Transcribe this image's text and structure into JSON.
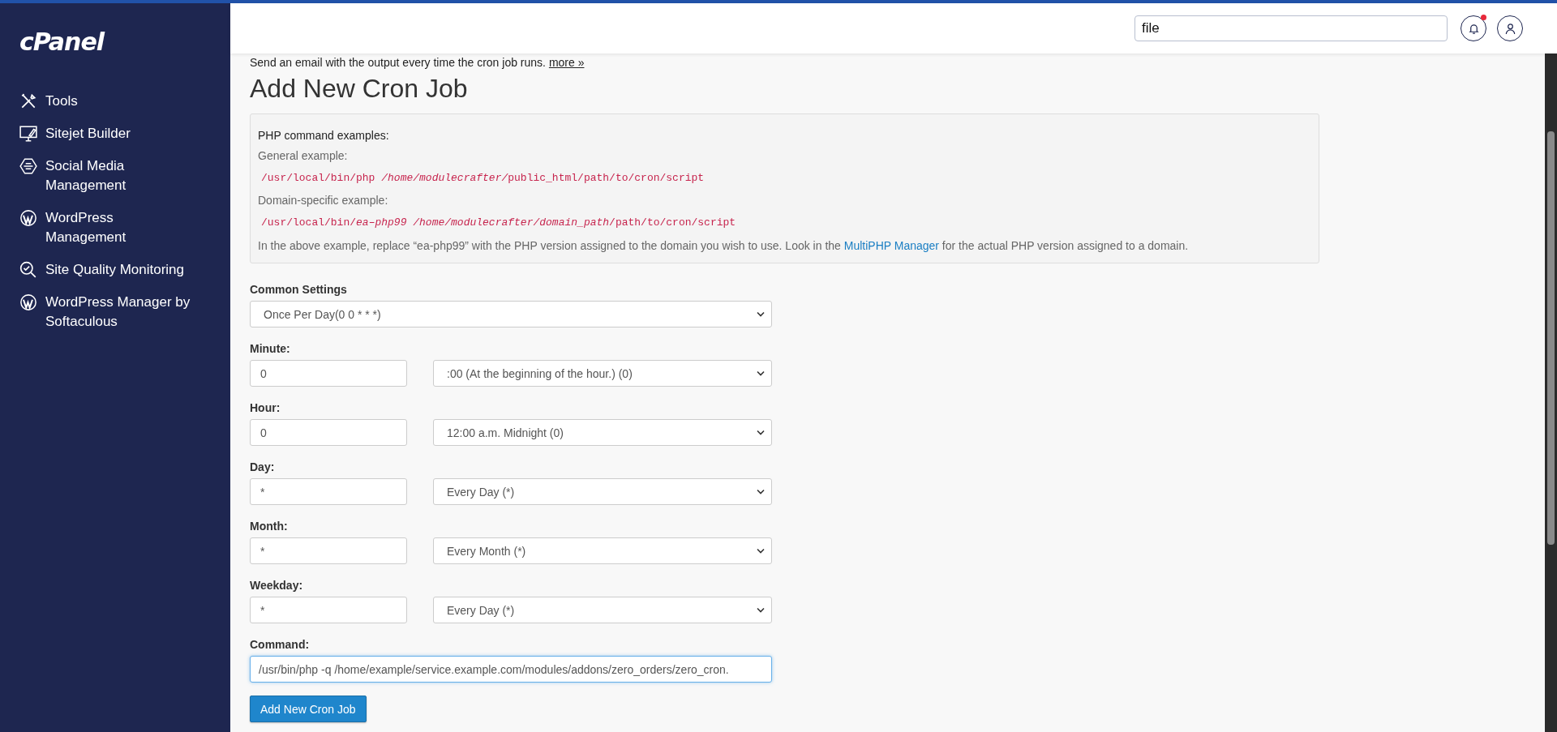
{
  "sidebar": {
    "logo": "cPanel",
    "items": [
      {
        "kind": "tools",
        "label": "Tools"
      },
      {
        "kind": "monitor",
        "label": "Sitejet Builder"
      },
      {
        "kind": "social",
        "label": "Social Media Management"
      },
      {
        "kind": "wordpress",
        "label": "WordPress Management"
      },
      {
        "kind": "quality",
        "label": "Site Quality Monitoring"
      },
      {
        "kind": "wordpress",
        "label": "WordPress Manager by Softaculous"
      }
    ]
  },
  "header": {
    "search": {
      "value": "file"
    },
    "notification": true
  },
  "intro": {
    "text": "Send an email with the output every time the cron job runs.",
    "link": "more »"
  },
  "title": "Add New Cron Job",
  "examples": {
    "heading": "PHP command examples:",
    "items": [
      {
        "label": "General example:",
        "code": [
          {
            "text": "/usr/local/bin/php ",
            "italic": false
          },
          {
            "text": "/home/modulecrafter/",
            "italic": true
          },
          {
            "text": "public_html/path/to/cron/script",
            "italic": false
          }
        ]
      },
      {
        "label": "Domain-specific example:",
        "code": [
          {
            "text": "/usr/local/bin/",
            "italic": false
          },
          {
            "text": "ea–php99 /home/modulecrafter/domain_path",
            "italic": true
          },
          {
            "text": "/path/to/cron/script",
            "italic": false
          }
        ]
      }
    ],
    "note_before": "In the above example, replace “ea-php99” with the PHP version assigned to the domain you wish to use. Look in the",
    "note_link": "MultiPHP Manager",
    "note_after": "for the actual PHP version assigned to a domain."
  },
  "common_settings": {
    "label": "Common Settings",
    "value": "Once Per Day(0 0 * * *)"
  },
  "fields": [
    {
      "label": "Minute:",
      "value": "0",
      "option": ":00 (At the beginning of the hour.) (0)"
    },
    {
      "label": "Hour:",
      "value": "0",
      "option": "12:00 a.m. Midnight (0)"
    },
    {
      "label": "Day:",
      "value": "*",
      "option": "Every Day (*)"
    },
    {
      "label": "Month:",
      "value": "*",
      "option": "Every Month (*)"
    },
    {
      "label": "Weekday:",
      "value": "*",
      "option": "Every Day (*)"
    }
  ],
  "command": {
    "label": "Command:",
    "value": "/usr/bin/php -q /home/example/service.example.com/modules/addons/zero_orders/zero_cron.",
    "focused": true
  },
  "submit": "Add New Cron Job"
}
